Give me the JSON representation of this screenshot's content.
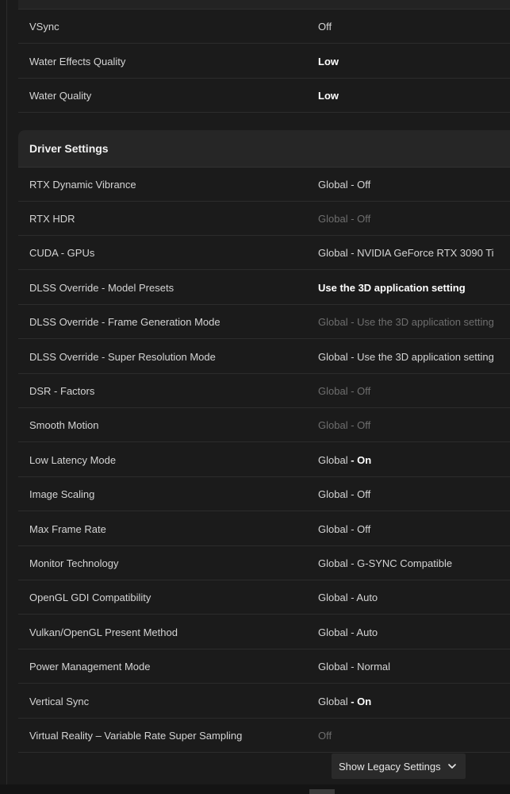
{
  "top_rows": [
    {
      "label": "VSync",
      "value": "Off",
      "style": "normal"
    },
    {
      "label": "Water Effects Quality",
      "value": "Low",
      "style": "bold"
    },
    {
      "label": "Water Quality",
      "value": "Low",
      "style": "bold"
    }
  ],
  "driver_section": {
    "title": "Driver Settings",
    "rows": [
      {
        "label": "RTX Dynamic Vibrance",
        "value": "Global - Off",
        "style": "normal"
      },
      {
        "label": "RTX HDR",
        "value": "Global - Off",
        "style": "dim"
      },
      {
        "label": "CUDA - GPUs",
        "value": "Global - NVIDIA GeForce RTX 3090 Ti",
        "style": "normal"
      },
      {
        "label": "DLSS Override - Model Presets",
        "value": "Use the 3D application setting",
        "style": "bold"
      },
      {
        "label": "DLSS Override - Frame Generation Mode",
        "value": "Global - Use the 3D application setting",
        "style": "dim"
      },
      {
        "label": "DLSS Override - Super Resolution Mode",
        "value": "Global - Use the 3D application setting",
        "style": "normal"
      },
      {
        "label": "DSR - Factors",
        "value": "Global - Off",
        "style": "dim"
      },
      {
        "label": "Smooth Motion",
        "value": "Global - Off",
        "style": "dim"
      },
      {
        "label": "Low Latency Mode",
        "value_prefix": "Global ",
        "value_strong": "- On",
        "style": "mixed"
      },
      {
        "label": "Image Scaling",
        "value": "Global - Off",
        "style": "normal"
      },
      {
        "label": "Max Frame Rate",
        "value": "Global - Off",
        "style": "normal"
      },
      {
        "label": "Monitor Technology",
        "value": "Global - G-SYNC Compatible",
        "style": "normal"
      },
      {
        "label": "OpenGL GDI Compatibility",
        "value": "Global - Auto",
        "style": "normal"
      },
      {
        "label": "Vulkan/OpenGL Present Method",
        "value": "Global - Auto",
        "style": "normal"
      },
      {
        "label": "Power Management Mode",
        "value": "Global - Normal",
        "style": "normal"
      },
      {
        "label": "Vertical Sync",
        "value_prefix": "Global ",
        "value_strong": "- On",
        "style": "mixed"
      },
      {
        "label": "Virtual Reality – Variable Rate Super Sampling",
        "value": "Off",
        "style": "dim"
      }
    ]
  },
  "legacy_button": {
    "label": "Show Legacy Settings",
    "icon": "chevron-down-icon"
  }
}
